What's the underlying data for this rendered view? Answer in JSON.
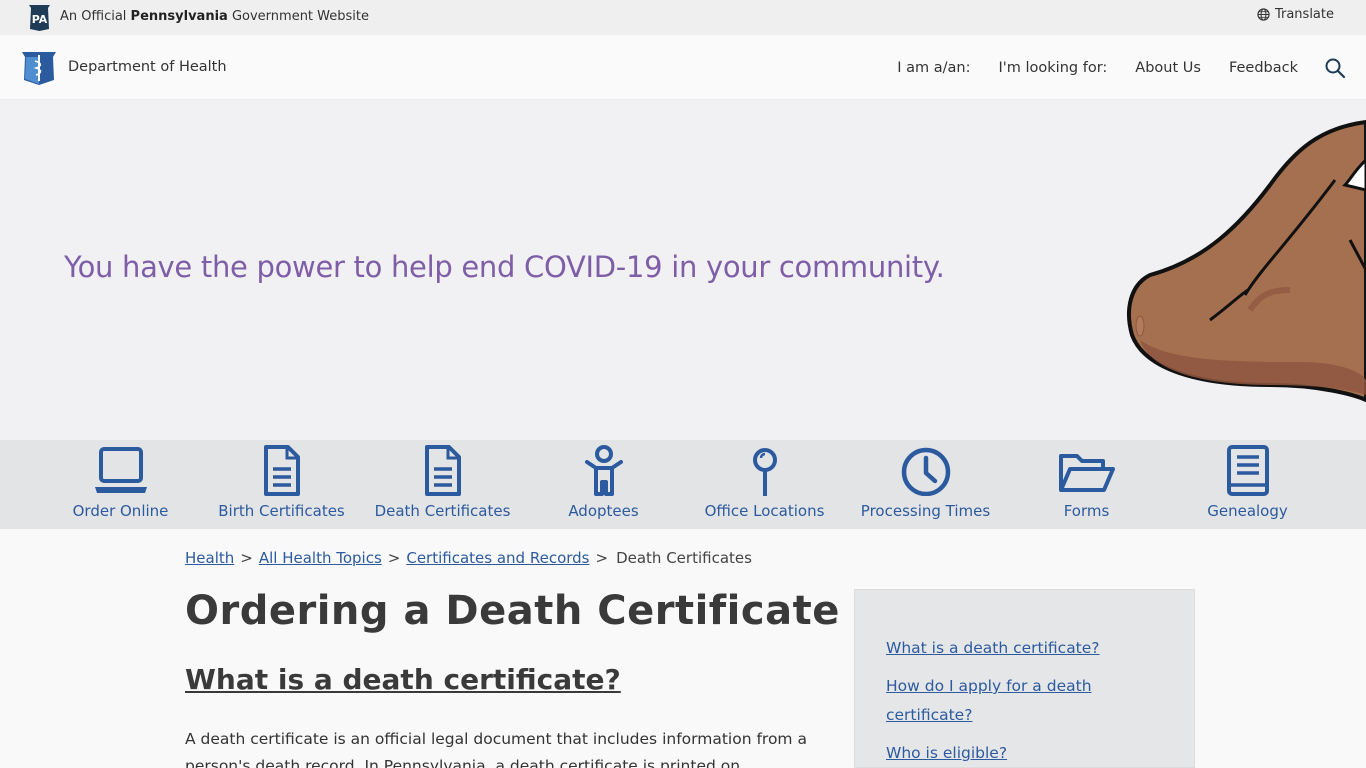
{
  "topbar": {
    "badge_text": "PA",
    "official_prefix": "An Official",
    "official_state": "Pennsylvania",
    "official_suffix": "Government Website",
    "translate_label": "Translate"
  },
  "header": {
    "department_name": "Department of Health",
    "nav": [
      {
        "label": "I am a/an:"
      },
      {
        "label": "I'm looking for:"
      },
      {
        "label": "About Us"
      },
      {
        "label": "Feedback"
      }
    ]
  },
  "hero": {
    "message": "You have the power to help end COVID-19 in your community."
  },
  "quick_links": [
    {
      "label": "Order Online",
      "icon": "laptop-icon"
    },
    {
      "label": "Birth Certificates",
      "icon": "document-icon"
    },
    {
      "label": "Death Certificates",
      "icon": "document-icon"
    },
    {
      "label": "Adoptees",
      "icon": "child-icon"
    },
    {
      "label": "Office Locations",
      "icon": "map-pin-icon"
    },
    {
      "label": "Processing Times",
      "icon": "clock-icon"
    },
    {
      "label": "Forms",
      "icon": "folder-open-icon"
    },
    {
      "label": "Genealogy",
      "icon": "book-icon"
    }
  ],
  "breadcrumb": {
    "items": [
      "Health",
      "All Health Topics",
      "Certificates and Records"
    ],
    "separator": ">",
    "current": "Death Certificates"
  },
  "main": {
    "title": "Ordering a Death Certificate",
    "section_title": "What is a death certificate?",
    "body": "A death certificate is an official legal document that includes information from a person's death record. In Pennsylvania, a death certificate is printed on"
  },
  "sidebar": {
    "links": [
      "What is a death certificate?",
      "How do I apply for a death certificate?",
      "Who is eligible?"
    ]
  },
  "colors": {
    "brand_blue": "#2c5a9e",
    "hero_purple": "#7f5ea8",
    "badge_navy": "#1f3b57"
  }
}
